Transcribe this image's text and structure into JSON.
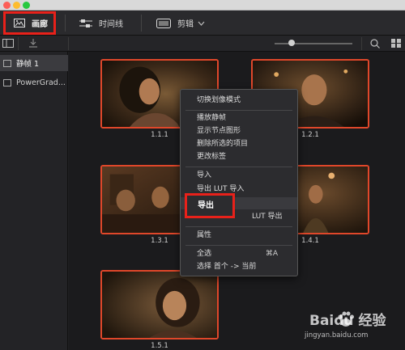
{
  "toolbar": {
    "gallery_label": "画廊",
    "timeline_label": "时间线",
    "edit_label": "剪辑"
  },
  "albums": [
    {
      "label": "静帧 1"
    },
    {
      "label": "PowerGrad..."
    }
  ],
  "stills": [
    {
      "label": "1.1.1"
    },
    {
      "label": "1.2.1"
    },
    {
      "label": "1.3.1"
    },
    {
      "label": "1.4.1"
    },
    {
      "label": "1.5.1"
    }
  ],
  "context_menu": {
    "switch_mode": "切换划像模式",
    "play_still": "播放静帧",
    "show_node_graph": "显示节点图形",
    "delete_selected": "删除所选的项目",
    "change_label": "更改标签",
    "import": "导入",
    "import_lut_partial": "导出 LUT 导入",
    "export": "导出",
    "export_lut_partial": "LUT 导出",
    "properties": "属性",
    "select_all": "全选",
    "select_all_shortcut": "⌘A",
    "select_first_to_current": "选择 首个 -> 当前"
  },
  "slider": {
    "value": 0.22
  },
  "watermark": {
    "main": "Baidu 经验",
    "sub": "jingyan.baidu.com"
  },
  "colors": {
    "selection_border": "#e8211a",
    "still_border": "#e0472a"
  }
}
